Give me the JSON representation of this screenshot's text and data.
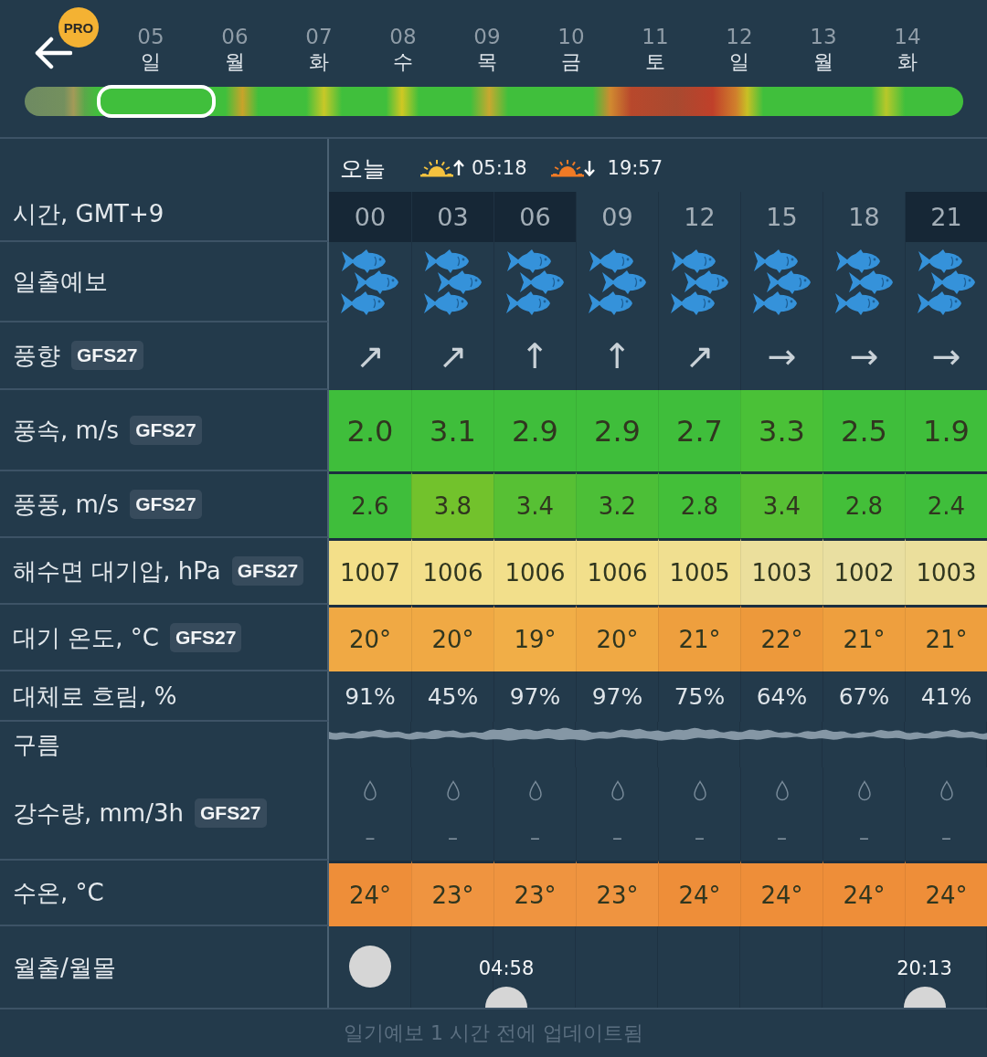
{
  "header": {
    "pro_badge": "PRO",
    "days": [
      {
        "date": "05",
        "weekday": "일",
        "selected": true
      },
      {
        "date": "06",
        "weekday": "월",
        "selected": false
      },
      {
        "date": "07",
        "weekday": "화",
        "selected": false
      },
      {
        "date": "08",
        "weekday": "수",
        "selected": false
      },
      {
        "date": "09",
        "weekday": "목",
        "selected": false
      },
      {
        "date": "10",
        "weekday": "금",
        "selected": false
      },
      {
        "date": "11",
        "weekday": "토",
        "selected": false
      },
      {
        "date": "12",
        "weekday": "일",
        "selected": false
      },
      {
        "date": "13",
        "weekday": "월",
        "selected": false
      },
      {
        "date": "14",
        "weekday": "화",
        "selected": false
      }
    ]
  },
  "day_bar": {
    "label": "오늘",
    "sunrise": "05:18",
    "sunset": "19:57"
  },
  "rows": [
    {
      "kind": "time",
      "label": "시간, GMT+9",
      "cells": [
        {
          "text": "00",
          "night": true
        },
        {
          "text": "03",
          "night": true
        },
        {
          "text": "06",
          "night": true
        },
        {
          "text": "09",
          "night": false
        },
        {
          "text": "12",
          "night": false
        },
        {
          "text": "15",
          "night": false
        },
        {
          "text": "18",
          "night": false
        },
        {
          "text": "21",
          "night": true
        }
      ]
    },
    {
      "kind": "fish",
      "label": "일출예보",
      "cells": [
        {
          "kind": "school"
        },
        {
          "kind": "school"
        },
        {
          "kind": "school"
        },
        {
          "kind": "school"
        },
        {
          "kind": "school"
        },
        {
          "kind": "school"
        },
        {
          "kind": "school"
        },
        {
          "kind": "school"
        }
      ]
    },
    {
      "kind": "direction",
      "label": "풍향",
      "badge": "GFS27",
      "cells": [
        {
          "text": "↗"
        },
        {
          "text": "↗"
        },
        {
          "text": "↑"
        },
        {
          "text": "↑"
        },
        {
          "text": "↗"
        },
        {
          "text": "→"
        },
        {
          "text": "→"
        },
        {
          "text": "→"
        }
      ]
    },
    {
      "kind": "big_colored",
      "label": "풍속, m/s",
      "badge": "GFS27",
      "cells": [
        {
          "text": "2.0",
          "color": "#3fbe3b"
        },
        {
          "text": "3.1",
          "color": "#3fbe3b"
        },
        {
          "text": "2.9",
          "color": "#3fbe3b"
        },
        {
          "text": "2.9",
          "color": "#3fbe3b"
        },
        {
          "text": "2.7",
          "color": "#3fbe3b"
        },
        {
          "text": "3.3",
          "color": "#4ac137"
        },
        {
          "text": "2.5",
          "color": "#3fbe3b"
        },
        {
          "text": "1.9",
          "color": "#3fbe3b"
        }
      ]
    },
    {
      "kind": "colored",
      "label": "풍풍, m/s",
      "badge": "GFS27",
      "cells": [
        {
          "text": "2.6",
          "color": "#3fbe3b"
        },
        {
          "text": "3.8",
          "color": "#72c22c"
        },
        {
          "text": "3.4",
          "color": "#57c034"
        },
        {
          "text": "3.2",
          "color": "#4cbf37"
        },
        {
          "text": "2.8",
          "color": "#43bf39"
        },
        {
          "text": "3.4",
          "color": "#57c034"
        },
        {
          "text": "2.8",
          "color": "#43bf39"
        },
        {
          "text": "2.4",
          "color": "#3fbe3b"
        }
      ]
    },
    {
      "kind": "colored",
      "label": "해수면 대기압, hPa",
      "badge": "GFS27",
      "cells": [
        {
          "text": "1007",
          "color": "#f3df89"
        },
        {
          "text": "1006",
          "color": "#f2df8b"
        },
        {
          "text": "1006",
          "color": "#f2df8b"
        },
        {
          "text": "1006",
          "color": "#f2df8b"
        },
        {
          "text": "1005",
          "color": "#f0df90"
        },
        {
          "text": "1003",
          "color": "#ebdf9c"
        },
        {
          "text": "1002",
          "color": "#e9dfa1"
        },
        {
          "text": "1003",
          "color": "#ebdf9c"
        }
      ]
    },
    {
      "kind": "colored",
      "label": "대기 온도, °C",
      "badge": "GFS27",
      "cells": [
        {
          "text": "20°",
          "color": "#f0a944"
        },
        {
          "text": "20°",
          "color": "#f0a944"
        },
        {
          "text": "19°",
          "color": "#f1ae47"
        },
        {
          "text": "20°",
          "color": "#f0a944"
        },
        {
          "text": "21°",
          "color": "#ee9f3e"
        },
        {
          "text": "22°",
          "color": "#ed993b"
        },
        {
          "text": "21°",
          "color": "#ee9f3e"
        },
        {
          "text": "21°",
          "color": "#ee9f3e"
        }
      ]
    },
    {
      "kind": "plain",
      "label": "대체로 흐림, %",
      "cells": [
        {
          "text": "91%"
        },
        {
          "text": "45%"
        },
        {
          "text": "97%"
        },
        {
          "text": "97%"
        },
        {
          "text": "75%"
        },
        {
          "text": "64%"
        },
        {
          "text": "67%"
        },
        {
          "text": "41%"
        }
      ]
    },
    {
      "kind": "cloud",
      "label": "구름"
    },
    {
      "kind": "precip",
      "label": "강수량, mm/3h",
      "badge": "GFS27",
      "cells": [
        {
          "text": "–"
        },
        {
          "text": "–"
        },
        {
          "text": "–"
        },
        {
          "text": "–"
        },
        {
          "text": "–"
        },
        {
          "text": "–"
        },
        {
          "text": "–"
        },
        {
          "text": "–"
        }
      ]
    },
    {
      "kind": "colored",
      "label": "수온, °C",
      "cells": [
        {
          "text": "24°",
          "color": "#ee8e39"
        },
        {
          "text": "23°",
          "color": "#ef9440"
        },
        {
          "text": "23°",
          "color": "#ef9440"
        },
        {
          "text": "23°",
          "color": "#ef9440"
        },
        {
          "text": "24°",
          "color": "#ee8e39"
        },
        {
          "text": "24°",
          "color": "#ee8e39"
        },
        {
          "text": "24°",
          "color": "#ee8e39"
        },
        {
          "text": "24°",
          "color": "#ee8e39"
        }
      ]
    },
    {
      "kind": "moon",
      "label": "월출/월몰",
      "moonrise": "04:58",
      "moonset": "20:13"
    }
  ],
  "footer": "일기예보 1 시간 전에 업데이트됨"
}
